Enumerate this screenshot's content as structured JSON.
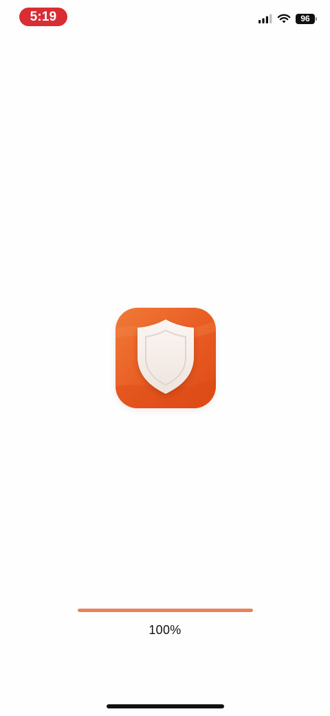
{
  "status_bar": {
    "time": "5:19",
    "time_pill_color": "#d92d33",
    "battery_level": "96",
    "signal_icon": "cellular-signal-icon",
    "wifi_icon": "wifi-icon",
    "battery_icon": "battery-icon"
  },
  "splash": {
    "app_icon": "shield-icon",
    "accent_color": "#e85b22",
    "progress_value": 1.0,
    "progress_label": "100%",
    "progress_color": "#e8825a"
  }
}
